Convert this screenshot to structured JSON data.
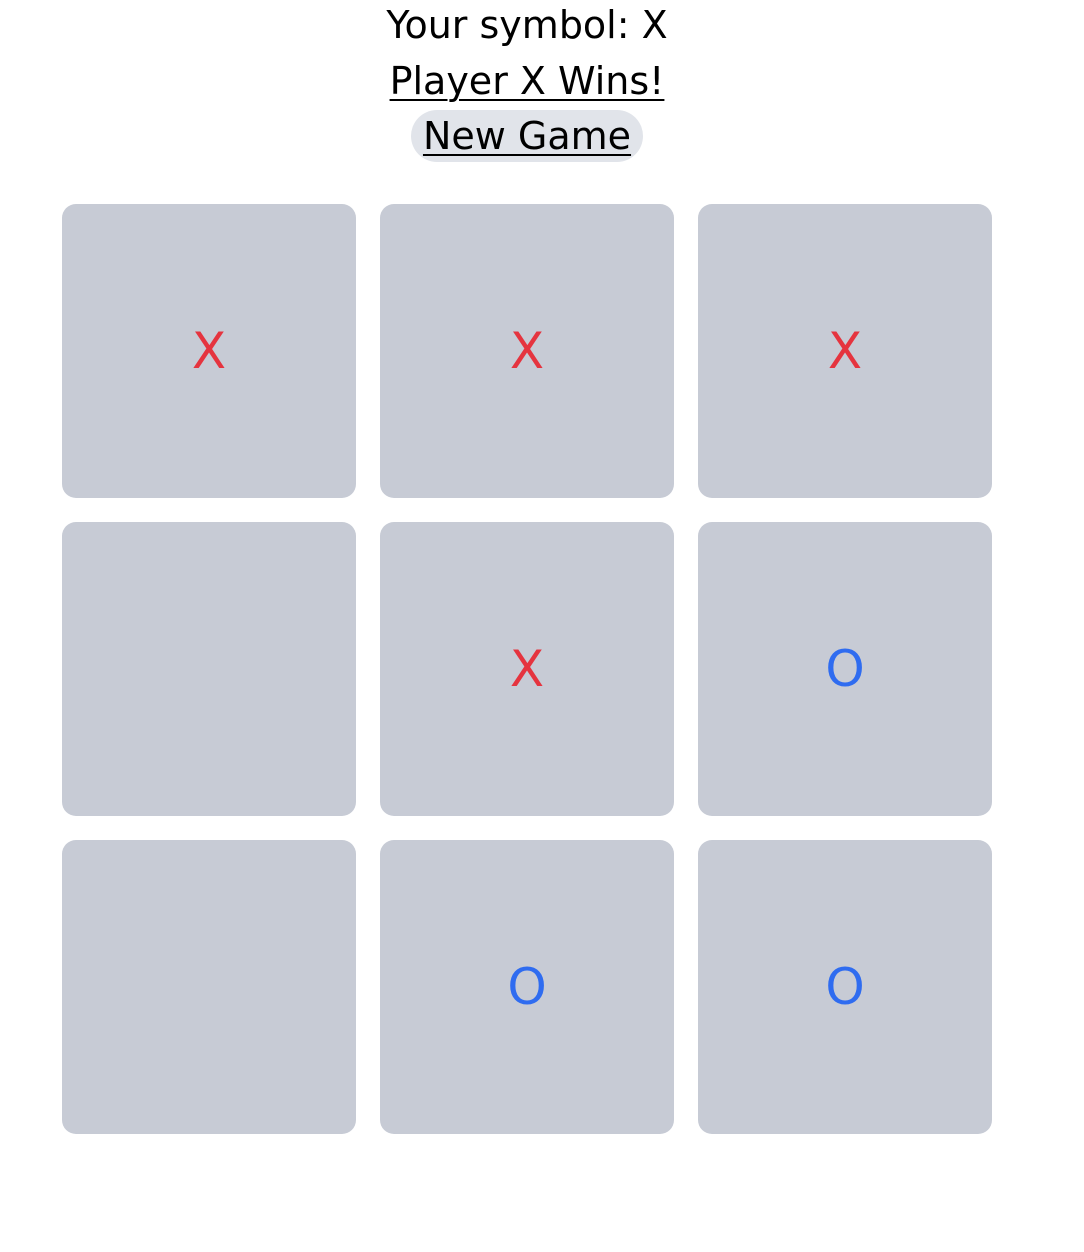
{
  "header": {
    "symbol_text": "Your symbol: X",
    "status_text": "Player X Wins!",
    "new_game_label": "New Game"
  },
  "board": {
    "cells": [
      {
        "value": "X",
        "mark": "x"
      },
      {
        "value": "X",
        "mark": "x"
      },
      {
        "value": "X",
        "mark": "x"
      },
      {
        "value": "",
        "mark": "empty"
      },
      {
        "value": "X",
        "mark": "x"
      },
      {
        "value": "O",
        "mark": "o"
      },
      {
        "value": "",
        "mark": "empty"
      },
      {
        "value": "O",
        "mark": "o"
      },
      {
        "value": "O",
        "mark": "o"
      }
    ]
  },
  "colors": {
    "x_color": "#e5343f",
    "o_color": "#2f6cf0",
    "cell_bg": "#c7cbd5",
    "button_bg": "#e1e4ea"
  }
}
